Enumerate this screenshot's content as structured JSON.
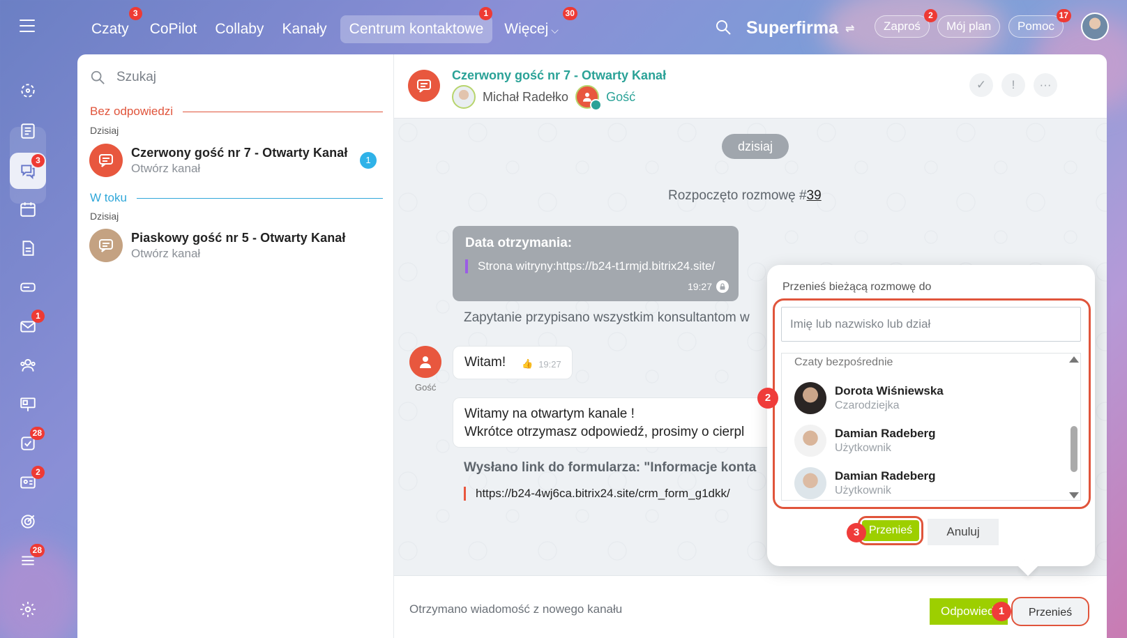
{
  "nav": {
    "items": [
      {
        "label": "Czaty",
        "badge": "3"
      },
      {
        "label": "CoPilot",
        "badge": ""
      },
      {
        "label": "Collaby",
        "badge": ""
      },
      {
        "label": "Kanały",
        "badge": ""
      },
      {
        "label": "Centrum kontaktowe",
        "badge": "1"
      },
      {
        "label": "Więcej",
        "badge": "30"
      }
    ],
    "brand": "Superfirma",
    "invite": {
      "label": "Zaproś",
      "badge": "2"
    },
    "plan": "Mój plan",
    "help": {
      "label": "Pomoc",
      "badge": "17"
    }
  },
  "sidebar": {
    "badges": {
      "chats": "3",
      "mail": "1",
      "tasks": "28",
      "crm": "2",
      "feed": "28"
    }
  },
  "list": {
    "search_placeholder": "Szukaj",
    "sections": [
      {
        "label": "Bez odpowiedzi",
        "day": "Dzisiaj",
        "color": "#e0543b",
        "item": {
          "title": "Czerwony gość nr 7 - Otwarty Kanał",
          "sub": "Otwórz kanał",
          "count": "1"
        }
      },
      {
        "label": "W toku",
        "day": "Dzisiaj",
        "color": "#2fa7d9",
        "item": {
          "title": "Piaskowy gość nr 5 - Otwarty Kanał",
          "sub": "Otwórz kanał",
          "count": ""
        }
      }
    ]
  },
  "chat": {
    "title": "Czerwony gość nr 7 - Otwarty Kanał",
    "operator": "Michał Radełko",
    "guest": "Gość",
    "day": "dzisiaj",
    "started_prefix": "Rozpoczęto rozmowę #",
    "started_number": "39",
    "received_title": "Data otrzymania:",
    "received_quote": "Strona witryny:https://b24-t1rmjd.bitrix24.site/",
    "received_time": "19:27",
    "assigned_text": "Zapytanie przypisano wszystkim konsultantom w",
    "msg1": {
      "text": "Witam!",
      "time": "19:27"
    },
    "msg1_author": "Gość",
    "msg2_line1": "Witamy na otwartym kanale !",
    "msg2_line2": "Wkrótce otrzymasz odpowiedź, prosimy o cierpl",
    "form_title": "Wysłano link do formularza: \"Informacje konta",
    "form_link": "https://b24-4wj6ca.bitrix24.site/crm_form_g1dkk/",
    "footer_text": "Otrzymano wiadomość z nowego kanału",
    "answer_btn": "Odpowiedz",
    "transfer_btn": "Przenieś"
  },
  "popup": {
    "title": "Przenieś bieżącą rozmowę do",
    "input_placeholder": "Imię lub nazwisko lub dział",
    "group_label": "Czaty bezpośrednie",
    "users": [
      {
        "name": "Dorota Wiśniewska",
        "role": "Czarodziejka"
      },
      {
        "name": "Damian Radeberg",
        "role": "Użytkownik"
      },
      {
        "name": "Damian Radeberg",
        "role": "Użytkownik"
      }
    ],
    "transfer_btn": "Przenieś",
    "cancel_btn": "Anuluj"
  },
  "callouts": [
    "1",
    "2",
    "3"
  ],
  "colors": {
    "accent_green": "#9dcf00",
    "title_teal": "#2aa297",
    "alert_red": "#e0543b",
    "badge_red": "#ee3a34"
  }
}
